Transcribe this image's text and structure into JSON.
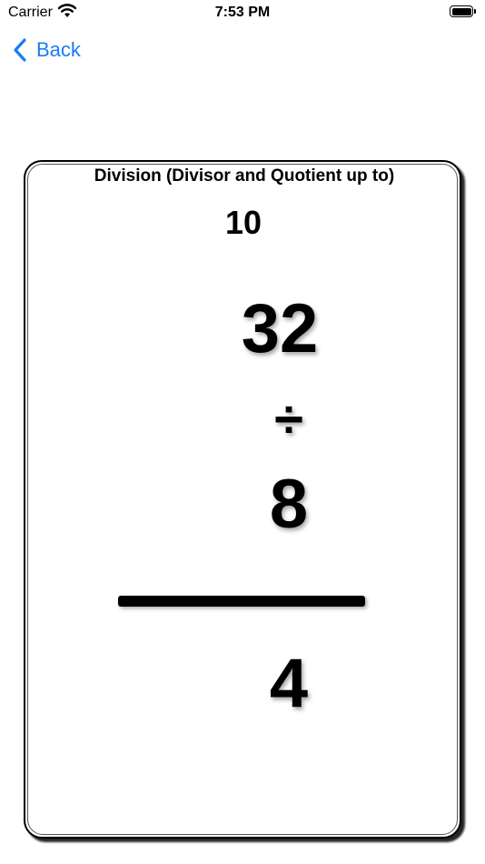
{
  "status_bar": {
    "carrier": "Carrier",
    "time": "7:53 PM"
  },
  "nav": {
    "back_label": "Back",
    "accent_color": "#1a7cf5"
  },
  "card": {
    "title": "Division (Divisor and Quotient up to)",
    "limit": "10",
    "dividend": "32",
    "operator": "÷",
    "divisor": "8",
    "quotient": "4"
  }
}
